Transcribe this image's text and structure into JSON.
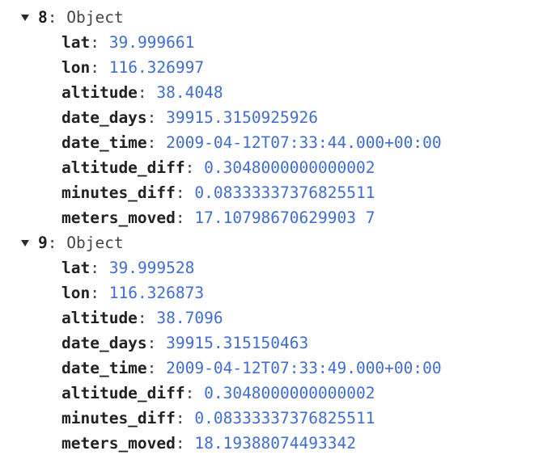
{
  "objects": [
    {
      "index": "8",
      "type": "Object",
      "props": [
        {
          "key": "lat",
          "value": "39.999661"
        },
        {
          "key": "lon",
          "value": "116.326997"
        },
        {
          "key": "altitude",
          "value": "38.4048"
        },
        {
          "key": "date_days",
          "value": "39915.3150925926"
        },
        {
          "key": "date_time",
          "value": "2009-04-12T07:33:44.000+00:00"
        },
        {
          "key": "altitude_diff",
          "value": "0.3048000000000002"
        },
        {
          "key": "minutes_diff",
          "value": "0.08333337376825511"
        },
        {
          "key": "meters_moved",
          "value": "17.10798670629903 7"
        }
      ]
    },
    {
      "index": "9",
      "type": "Object",
      "props": [
        {
          "key": "lat",
          "value": "39.999528"
        },
        {
          "key": "lon",
          "value": "116.326873"
        },
        {
          "key": "altitude",
          "value": "38.7096"
        },
        {
          "key": "date_days",
          "value": "39915.315150463"
        },
        {
          "key": "date_time",
          "value": "2009-04-12T07:33:49.000+00:00"
        },
        {
          "key": "altitude_diff",
          "value": "0.3048000000000002"
        },
        {
          "key": "minutes_diff",
          "value": "0.08333337376825511"
        },
        {
          "key": "meters_moved",
          "value": "18.19388074493342"
        }
      ]
    }
  ],
  "separator": ": ",
  "icons": {
    "toggle": "triangle-down-icon"
  },
  "colors": {
    "value": "#3f6dd3",
    "key": "#222222",
    "background": "#ffffff"
  }
}
